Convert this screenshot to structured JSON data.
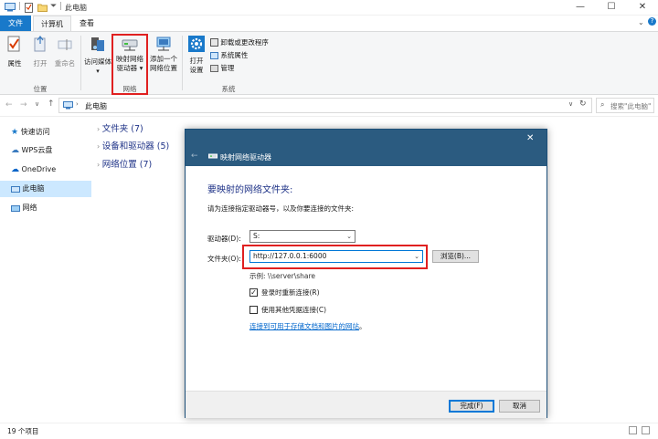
{
  "window": {
    "title": "此电脑",
    "controls": [
      "minimize",
      "maximize",
      "close"
    ]
  },
  "ribbon_tabs": [
    {
      "label": "文件",
      "active": true
    },
    {
      "label": "计算机",
      "selected": true
    },
    {
      "label": "查看"
    }
  ],
  "ribbon": {
    "location_group": {
      "label": "位置",
      "buttons": [
        "属性",
        "打开",
        "重命名"
      ]
    },
    "network_group": {
      "label": "网络",
      "access_media": "访问媒体",
      "map_drive_line1": "映射网络",
      "map_drive_line2": "驱动器",
      "add_location_line1": "添加一个",
      "add_location_line2": "网络位置"
    },
    "system_group": {
      "label": "系统",
      "open_settings_line1": "打开",
      "open_settings_line2": "设置",
      "uninstall": "卸载或更改程序",
      "system_properties": "系统属性",
      "manage": "管理"
    }
  },
  "address": {
    "path": "此电脑",
    "search_placeholder": "搜索\"此电脑\""
  },
  "nav_pane": {
    "items": [
      {
        "label": "快速访问",
        "icon": "star-icon"
      },
      {
        "label": "WPS云盘",
        "icon": "cloud-icon"
      },
      {
        "label": "OneDrive",
        "icon": "onedrive-icon"
      },
      {
        "label": "此电脑",
        "icon": "computer-icon",
        "selected": true
      },
      {
        "label": "网络",
        "icon": "network-icon"
      }
    ]
  },
  "content_groups": [
    {
      "label": "文件夹 (7)"
    },
    {
      "label": "设备和驱动器 (5)"
    },
    {
      "label": "网络位置 (7)"
    }
  ],
  "status": {
    "item_count": "19 个项目"
  },
  "dialog": {
    "title": "映射网络驱动器",
    "heading": "要映射的网络文件夹:",
    "instruction": "请为连接指定驱动器号，以及你要连接的文件夹:",
    "drive_label": "驱动器(D):",
    "drive_value": "S:",
    "folder_label": "文件夹(O):",
    "folder_value": "http://127.0.0.1:6000",
    "browse_button": "浏览(B)...",
    "example": "示例: \\\\server\\share",
    "reconnect_label": "登录时重新连接(R)",
    "reconnect_checked": true,
    "other_creds_label": "使用其他凭据连接(C)",
    "other_creds_checked": false,
    "link_text": "连接到可用于存储文档和图片的网站",
    "link_suffix": "。",
    "finish_button": "完成(F)",
    "cancel_button": "取消"
  },
  "colors": {
    "accent": "#0078d7",
    "dialog_title_bg": "#2b5b80",
    "highlight_red": "#e02020",
    "group_blue": "#1e3287",
    "link_blue": "#0066cc"
  }
}
